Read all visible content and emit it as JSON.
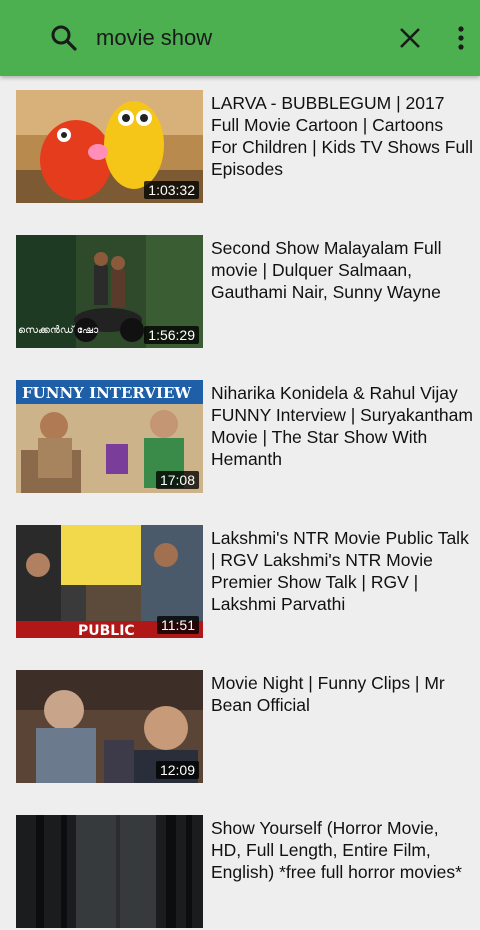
{
  "search": {
    "query": "movie show",
    "icons": {
      "search": "search-icon",
      "clear": "close-icon",
      "menu": "more-vert-icon"
    }
  },
  "colors": {
    "toolbar": "#4caf50",
    "background": "#eeeeee"
  },
  "results": [
    {
      "title": "LARVA - BUBBLEGUM | 2017 Full Movie Cartoon | Cartoons For Children | Kids TV Shows Full Episodes",
      "duration": "1:03:32"
    },
    {
      "title": "Second Show Malayalam Full movie | Dulquer Salmaan, Gauthami Nair, Sunny Wayne",
      "duration": "1:56:29",
      "thumb_caption": "സെക്കൻഡ് ഷോ"
    },
    {
      "title": "Niharika Konidela & Rahul Vijay FUNNY Interview | Suryakantham Movie | The Star Show With Hemanth",
      "duration": "17:08",
      "thumb_caption": "FUNNY INTERVIEW"
    },
    {
      "title": "Lakshmi's NTR Movie Public Talk | RGV Lakshmi's NTR Movie Premier Show Talk | RGV | Lakshmi Parvathi",
      "duration": "11:51",
      "thumb_caption": "PUBLIC"
    },
    {
      "title": "Movie Night | Funny Clips | Mr Bean Official",
      "duration": "12:09"
    },
    {
      "title": "Show Yourself (Horror Movie, HD, Full Length, Entire Film, English) *free full horror movies*",
      "duration": ""
    }
  ]
}
